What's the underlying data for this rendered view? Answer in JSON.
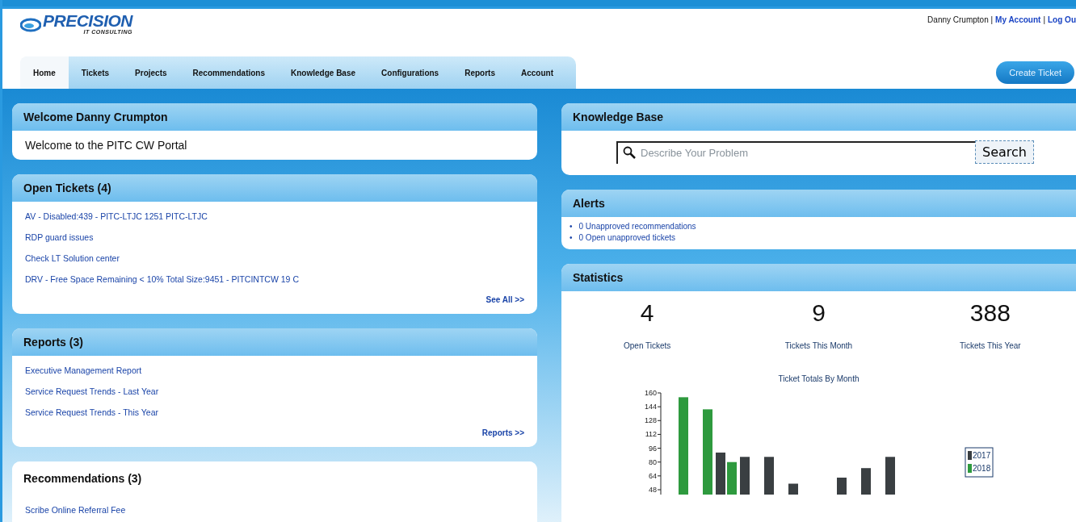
{
  "header": {
    "logo": {
      "name": "PRECISION",
      "tagline": "IT CONSULTING"
    },
    "user_name": "Danny Crumpton |",
    "account_link": "My Account",
    "separator": "|",
    "logout_link": "Log Ou",
    "create_button": "Create Ticket"
  },
  "nav": [
    {
      "label": "Home",
      "selected": true
    },
    {
      "label": "Tickets",
      "selected": false
    },
    {
      "label": "Projects",
      "selected": false
    },
    {
      "label": "Recommendations",
      "selected": false
    },
    {
      "label": "Knowledge Base",
      "selected": false
    },
    {
      "label": "Configurations",
      "selected": false
    },
    {
      "label": "Reports",
      "selected": false
    },
    {
      "label": "Account",
      "selected": false
    }
  ],
  "left": [
    {
      "kind": "message",
      "title": "Welcome Danny Crumpton",
      "text": "Welcome to the PITC CW Portal"
    },
    {
      "kind": "links",
      "title": "Open Tickets (4)",
      "items": [
        "AV - Disabled:439 - PITC-LTJC 1251 PITC-LTJC",
        "RDP guard issues",
        "Check LT Solution center",
        "DRV - Free Space Remaining < 10% Total Size:9451 - PITCINTCW 19 C"
      ],
      "more_link": "See All >>"
    },
    {
      "kind": "links",
      "title": "Reports (3)",
      "items": [
        "Executive Management Report",
        "Service Request Trends - Last Year",
        "Service Request Trends - This Year"
      ],
      "more_link": "Reports >>"
    },
    {
      "kind": "plain",
      "title": "Recommendations (3)",
      "items": [
        "Scribe Online Referral Fee"
      ]
    }
  ],
  "knowledge_base": {
    "title": "Knowledge Base",
    "placeholder": "Describe Your Problem",
    "button": "Search"
  },
  "alerts": {
    "title": "Alerts",
    "items": [
      {
        "bullet": "•",
        "text": "0 Unapproved recommendations"
      },
      {
        "bullet": "•",
        "text": "0 Open unapproved tickets"
      }
    ]
  },
  "statistics": {
    "title": "Statistics",
    "stats": [
      {
        "value": "4",
        "label": "Open Tickets"
      },
      {
        "value": "9",
        "label": "Tickets This Month"
      },
      {
        "value": "388",
        "label": "Tickets This Year"
      }
    ],
    "chart": {
      "title": "Ticket Totals By Month",
      "y_tick_labels": [
        "160",
        "144",
        "128",
        "112",
        "96",
        "80",
        "64",
        "48"
      ],
      "legend": [
        {
          "name": "2017",
          "color": "#3a3f42"
        },
        {
          "name": "2018",
          "color": "#2e9a3e"
        }
      ]
    }
  }
}
